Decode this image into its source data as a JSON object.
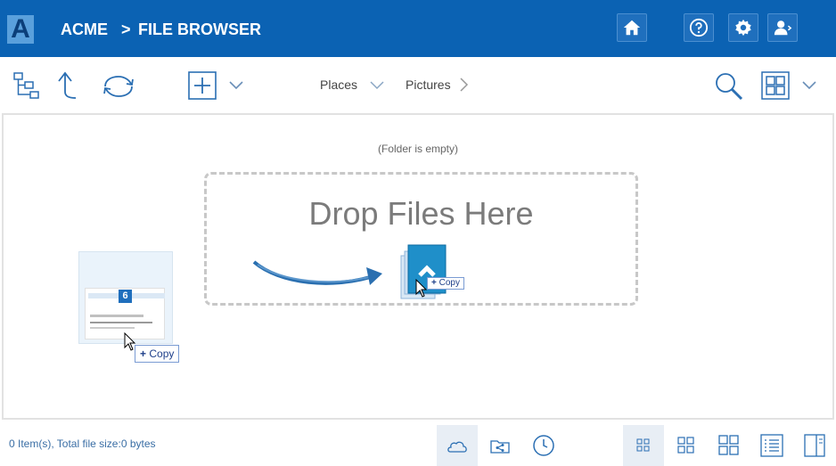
{
  "header": {
    "logo_letter": "A",
    "brand": "ACME",
    "separator": ">",
    "page_title": "FILE BROWSER",
    "buttons": [
      "home-icon",
      "help-icon",
      "settings-icon",
      "user-menu-icon"
    ],
    "color": "#0b62b3"
  },
  "toolbar": {
    "places_label": "Places",
    "pictures_label": "Pictures",
    "icons": [
      "folder-tree-icon",
      "up-arrow-icon",
      "refresh-icon",
      "new-item-icon",
      "chevron-down-icon",
      "search-icon",
      "grid-view-icon"
    ]
  },
  "content": {
    "empty_message": "(Folder is empty)",
    "drop_title": "Drop Files Here",
    "drag_count": "6",
    "copy_label": "Copy",
    "copy_label_small": "Copy"
  },
  "status": {
    "text": "0 Item(s), Total file size:0 bytes",
    "left_buttons": [
      "cloud-icon",
      "share-icon",
      "history-icon"
    ],
    "view_buttons": [
      "small-grid-icon",
      "medium-grid-icon",
      "large-grid-icon",
      "details-list-icon",
      "preview-pane-icon"
    ]
  }
}
